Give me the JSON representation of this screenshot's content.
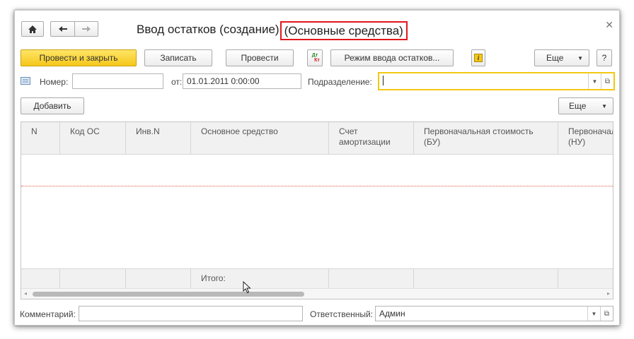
{
  "window": {
    "title_main": "Ввод остатков (создание)",
    "title_highlight": "(Основные средства)",
    "close_icon": "close-icon"
  },
  "nav": {
    "home_icon": "home-icon",
    "back_icon": "back-arrow-icon",
    "forward_icon": "forward-arrow-icon"
  },
  "toolbar": {
    "post_close": "Провести и закрыть",
    "save": "Записать",
    "post": "Провести",
    "dtkt_top": "Дт",
    "dtkt_bottom": "Кт",
    "mode": "Режим ввода остатков...",
    "more": "Еще",
    "help": "?",
    "info": "i"
  },
  "header": {
    "number_label": "Номер:",
    "number_value": "",
    "date_label": "от:",
    "date_value": "01.01.2011  0:00:00",
    "department_label": "Подразделение:",
    "department_value": ""
  },
  "table_toolbar": {
    "add": "Добавить",
    "more": "Еще"
  },
  "table": {
    "columns": [
      {
        "line1": "N",
        "line2": ""
      },
      {
        "line1": "Код ОС",
        "line2": ""
      },
      {
        "line1": "Инв.N",
        "line2": ""
      },
      {
        "line1": "Основное средство",
        "line2": ""
      },
      {
        "line1": "Счет",
        "line2": "амортизации"
      },
      {
        "line1": "Первоначальная стоимость",
        "line2": "(БУ)"
      },
      {
        "line1": "Первоначальная",
        "line2": "(НУ)"
      }
    ],
    "footer_total": "Итого:"
  },
  "footer": {
    "comment_label": "Комментарий:",
    "comment_value": "",
    "responsible_label": "Ответственный:",
    "responsible_value": "Админ"
  },
  "colors": {
    "primary_button": "#f5c71a",
    "highlight_box": "#e0171d",
    "focus_border": "#f2c811"
  }
}
